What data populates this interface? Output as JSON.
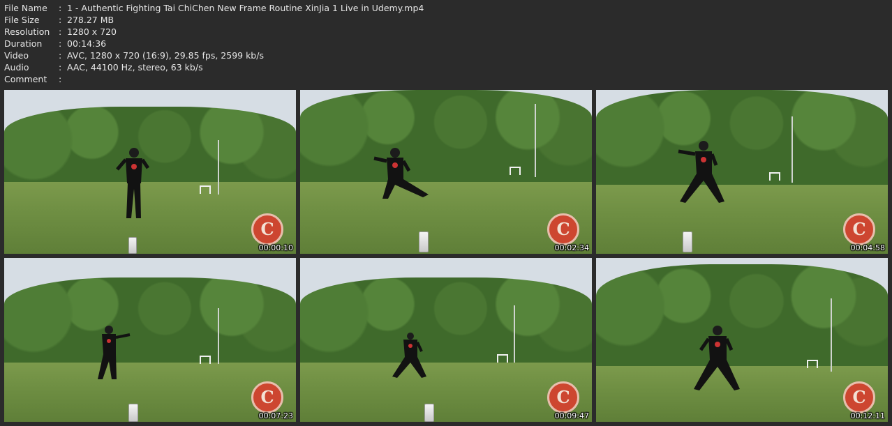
{
  "info": {
    "rows": [
      {
        "key": "File Name",
        "sep": ":",
        "value": "1 - Authentic Fighting Tai ChiChen New Frame Routine XinJia 1 Live in Udemy.mp4"
      },
      {
        "key": "File Size",
        "sep": ":",
        "value": "278.27 MB"
      },
      {
        "key": "Resolution",
        "sep": ":",
        "value": "1280 x 720"
      },
      {
        "key": "Duration",
        "sep": ":",
        "value": "00:14:36"
      },
      {
        "key": "Video",
        "sep": ":",
        "value": "AVC, 1280 x 720 (16:9), 29.85 fps, 2599 kb/s"
      },
      {
        "key": "Audio",
        "sep": ":",
        "value": "AAC, 44100 Hz, stereo, 63 kb/s"
      },
      {
        "key": "Comment",
        "sep": ":",
        "value": ""
      }
    ]
  },
  "thumbnails": [
    {
      "timestamp": "00:00:10"
    },
    {
      "timestamp": "00:02:34"
    },
    {
      "timestamp": "00:04:58"
    },
    {
      "timestamp": "00:07:23"
    },
    {
      "timestamp": "00:09:47"
    },
    {
      "timestamp": "00:12:11"
    }
  ],
  "colors": {
    "background": "#2b2b2b",
    "text": "#e6e6e6",
    "sky": "#d6dde4",
    "trees": "#3f6a2b",
    "grass": "#6f8f43",
    "logo": "#d6412f"
  },
  "icons": {
    "watermark": "dragon-logo-icon",
    "phone": "phone-icon"
  }
}
